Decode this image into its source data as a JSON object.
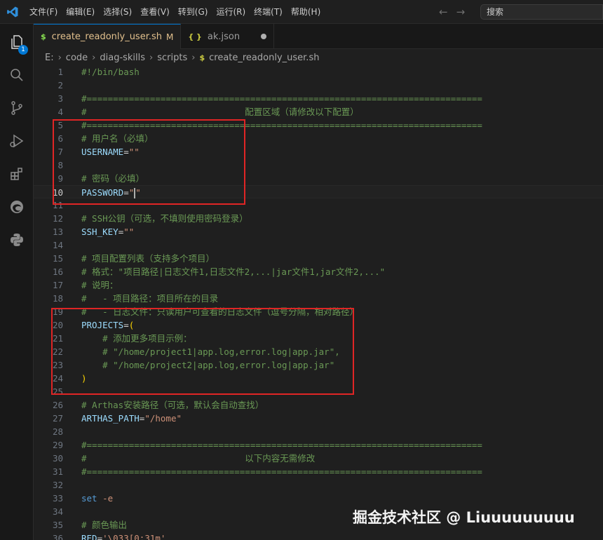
{
  "menu": [
    "文件(F)",
    "编辑(E)",
    "选择(S)",
    "查看(V)",
    "转到(G)",
    "运行(R)",
    "终端(T)",
    "帮助(H)"
  ],
  "search": {
    "label": "搜索"
  },
  "activity": {
    "explorer_badge": "1"
  },
  "tabs": [
    {
      "name": "create_readonly_user.sh",
      "icon": "$",
      "modified": "M"
    },
    {
      "name": "ak.json",
      "icon": "{ }"
    }
  ],
  "breadcrumb": [
    "E:",
    "code",
    "diag-skills",
    "scripts",
    "create_readonly_user.sh"
  ],
  "code": [
    {
      "n": "1",
      "text": "#!/bin/bash"
    },
    {
      "n": "2",
      "text": ""
    },
    {
      "n": "3",
      "text": "#==========================================================================="
    },
    {
      "n": "4",
      "text": "#                              配置区域（请修改以下配置）"
    },
    {
      "n": "5",
      "text": "#==========================================================================="
    },
    {
      "n": "6",
      "text": "# 用户名（必填）"
    },
    {
      "n": "7",
      "text": "USERNAME=\"\""
    },
    {
      "n": "8",
      "text": ""
    },
    {
      "n": "9",
      "text": "# 密码（必填）"
    },
    {
      "n": "10",
      "text": "PASSWORD=\"\""
    },
    {
      "n": "11",
      "text": ""
    },
    {
      "n": "12",
      "text": "# SSH公钥（可选，不填则使用密码登录）"
    },
    {
      "n": "13",
      "text": "SSH_KEY=\"\""
    },
    {
      "n": "14",
      "text": ""
    },
    {
      "n": "15",
      "text": "# 项目配置列表（支持多个项目）"
    },
    {
      "n": "16",
      "text": "# 格式：\"项目路径|日志文件1,日志文件2,...|jar文件1,jar文件2,...\""
    },
    {
      "n": "17",
      "text": "# 说明："
    },
    {
      "n": "18",
      "text": "#   - 项目路径：项目所在的目录"
    },
    {
      "n": "19",
      "text": "#   - 日志文件：只读用户可查看的日志文件（逗号分隔，相对路径）"
    },
    {
      "n": "20",
      "text": "PROJECTS=("
    },
    {
      "n": "21",
      "text": "    # 添加更多项目示例："
    },
    {
      "n": "22",
      "text": "    # \"/home/project1|app.log,error.log|app.jar\","
    },
    {
      "n": "23",
      "text": "    # \"/home/project2|app.log,error.log|app.jar\""
    },
    {
      "n": "24",
      "text": ")"
    },
    {
      "n": "25",
      "text": ""
    },
    {
      "n": "26",
      "text": "# Arthas安装路径（可选，默认会自动查找）"
    },
    {
      "n": "27",
      "text": "ARTHAS_PATH=\"/home\""
    },
    {
      "n": "28",
      "text": ""
    },
    {
      "n": "29",
      "text": "#==========================================================================="
    },
    {
      "n": "30",
      "text": "#                              以下内容无需修改"
    },
    {
      "n": "31",
      "text": "#==========================================================================="
    },
    {
      "n": "32",
      "text": ""
    },
    {
      "n": "33",
      "text": "set -e"
    },
    {
      "n": "34",
      "text": ""
    },
    {
      "n": "35",
      "text": "# 颜色输出"
    },
    {
      "n": "36",
      "text": "RED='\\033[0;31m'"
    }
  ],
  "watermark": "掘金技术社区 @ Liuuuuuuuuu",
  "colors": {
    "highlight_box": "#e02525",
    "accent": "#0078d4"
  }
}
